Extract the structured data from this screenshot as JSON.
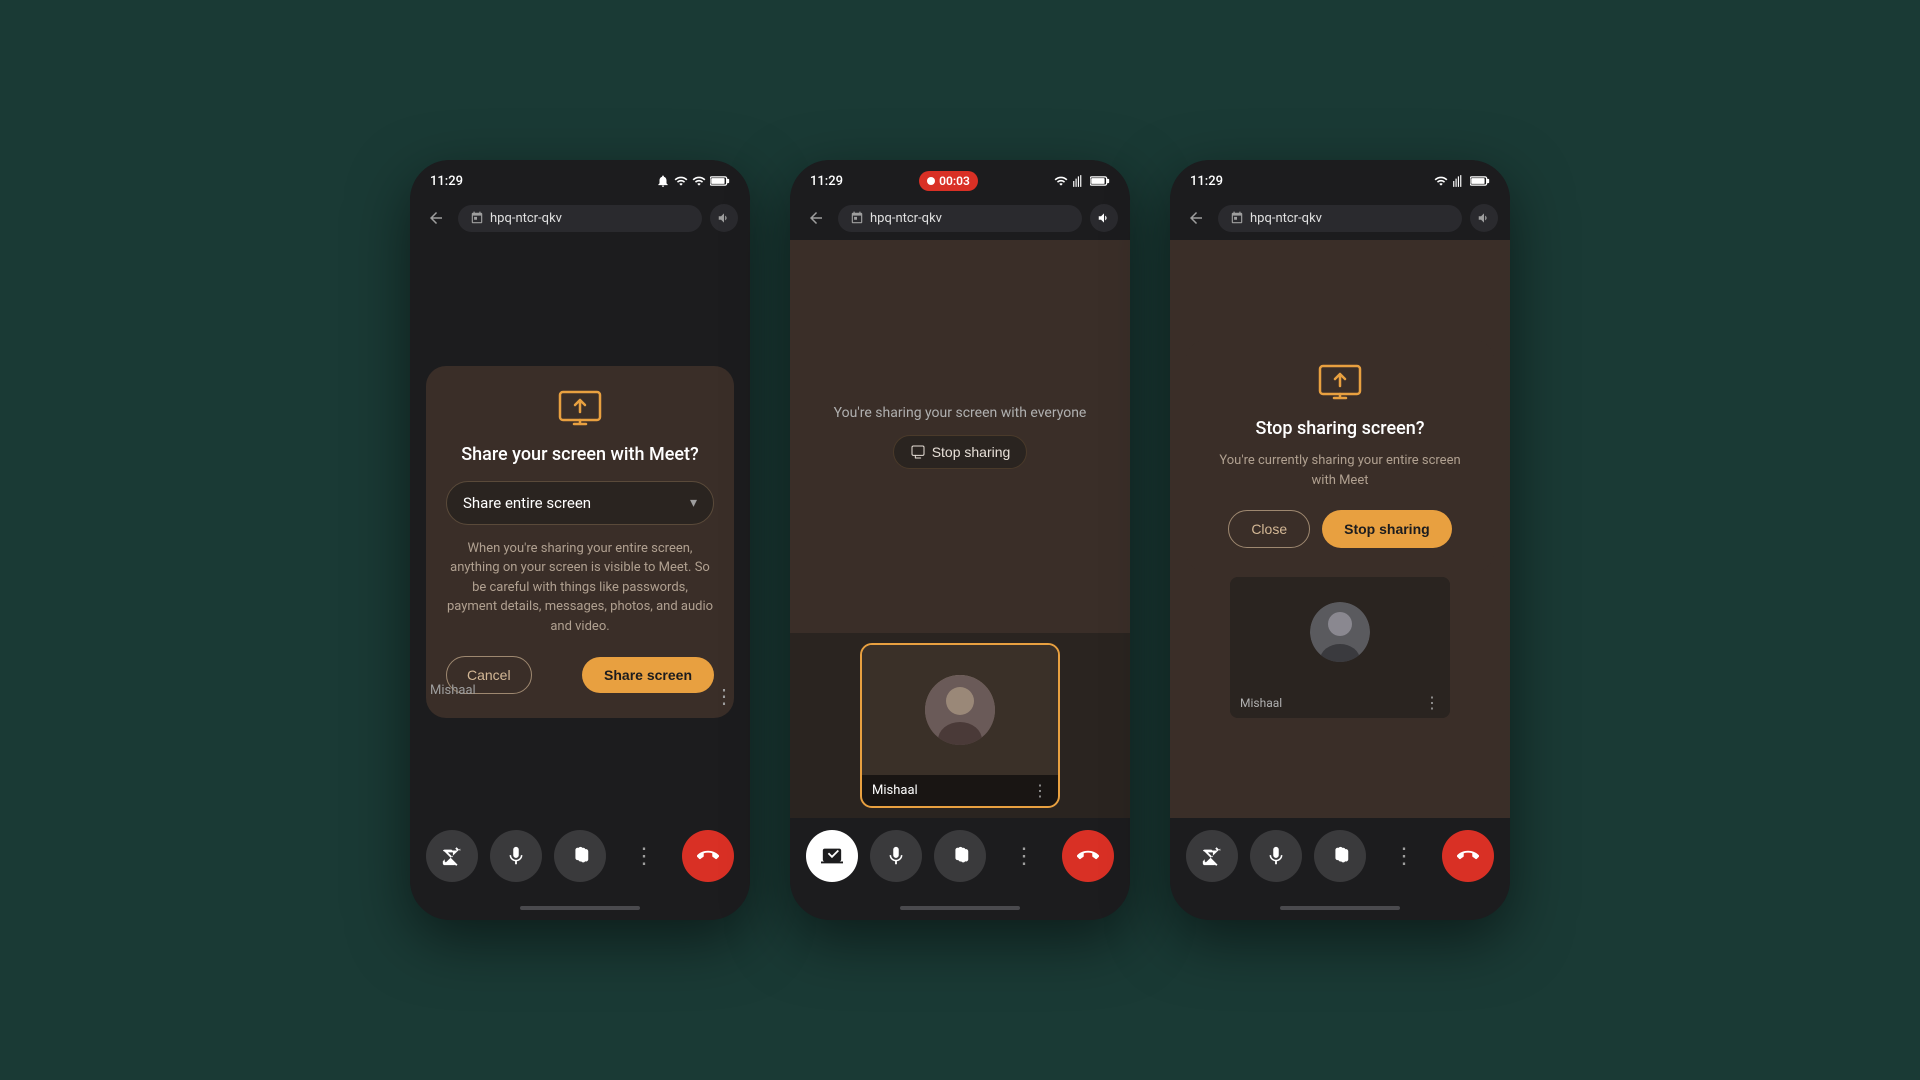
{
  "background_color": "#1a3a35",
  "phones": [
    {
      "id": "phone1",
      "status_bar": {
        "time": "11:29",
        "icons": [
          "wifi",
          "signal",
          "battery"
        ]
      },
      "address_bar": {
        "url": "hpq-ntcr-qkv"
      },
      "dialog": {
        "title": "Share your screen with Meet?",
        "dropdown_label": "Share entire screen",
        "description": "When you're sharing your entire screen, anything on your screen is visible to Meet. So be careful with things like passwords, payment details, messages, photos, and audio and video.",
        "cancel_button": "Cancel",
        "share_button": "Share screen"
      },
      "user_name": "Mishaal",
      "toolbar": {
        "buttons": [
          "camera-off",
          "mic",
          "hand",
          "more",
          "end-call"
        ]
      }
    },
    {
      "id": "phone2",
      "status_bar": {
        "time": "11:29",
        "recording": "00:03"
      },
      "address_bar": {
        "url": "hpq-ntcr-qkv"
      },
      "sharing_text": "You're sharing your screen with everyone",
      "stop_sharing_button": "Stop sharing",
      "user_name": "Mishaal",
      "toolbar": {
        "buttons": [
          "screen-share",
          "mic",
          "hand",
          "more",
          "end-call"
        ]
      }
    },
    {
      "id": "phone3",
      "status_bar": {
        "time": "11:29",
        "icons": [
          "wifi",
          "signal",
          "battery"
        ]
      },
      "address_bar": {
        "url": "hpq-ntcr-qkv"
      },
      "stop_dialog": {
        "title": "Stop sharing screen?",
        "description": "You're currently sharing your entire screen with Meet",
        "close_button": "Close",
        "stop_button": "Stop sharing"
      },
      "user_name": "Mishaal",
      "toolbar": {
        "buttons": [
          "camera-off",
          "mic",
          "hand",
          "more",
          "end-call"
        ]
      }
    }
  ]
}
